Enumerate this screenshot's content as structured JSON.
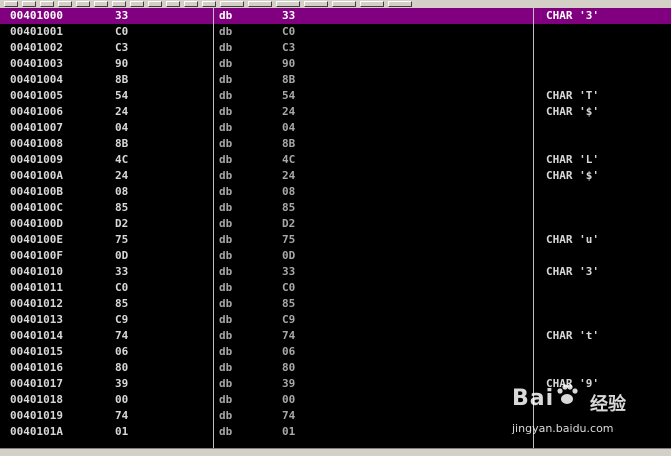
{
  "rows": [
    {
      "addr": "00401000",
      "hex": "33",
      "op": "db",
      "arg": "33",
      "comment": "CHAR '3'",
      "selected": true
    },
    {
      "addr": "00401001",
      "hex": "C0",
      "op": "db",
      "arg": "C0",
      "comment": ""
    },
    {
      "addr": "00401002",
      "hex": "C3",
      "op": "db",
      "arg": "C3",
      "comment": ""
    },
    {
      "addr": "00401003",
      "hex": "90",
      "op": "db",
      "arg": "90",
      "comment": ""
    },
    {
      "addr": "00401004",
      "hex": "8B",
      "op": "db",
      "arg": "8B",
      "comment": ""
    },
    {
      "addr": "00401005",
      "hex": "54",
      "op": "db",
      "arg": "54",
      "comment": "CHAR 'T'"
    },
    {
      "addr": "00401006",
      "hex": "24",
      "op": "db",
      "arg": "24",
      "comment": "CHAR '$'"
    },
    {
      "addr": "00401007",
      "hex": "04",
      "op": "db",
      "arg": "04",
      "comment": ""
    },
    {
      "addr": "00401008",
      "hex": "8B",
      "op": "db",
      "arg": "8B",
      "comment": ""
    },
    {
      "addr": "00401009",
      "hex": "4C",
      "op": "db",
      "arg": "4C",
      "comment": "CHAR 'L'"
    },
    {
      "addr": "0040100A",
      "hex": "24",
      "op": "db",
      "arg": "24",
      "comment": "CHAR '$'"
    },
    {
      "addr": "0040100B",
      "hex": "08",
      "op": "db",
      "arg": "08",
      "comment": ""
    },
    {
      "addr": "0040100C",
      "hex": "85",
      "op": "db",
      "arg": "85",
      "comment": ""
    },
    {
      "addr": "0040100D",
      "hex": "D2",
      "op": "db",
      "arg": "D2",
      "comment": ""
    },
    {
      "addr": "0040100E",
      "hex": "75",
      "op": "db",
      "arg": "75",
      "comment": "CHAR 'u'"
    },
    {
      "addr": "0040100F",
      "hex": "0D",
      "op": "db",
      "arg": "0D",
      "comment": ""
    },
    {
      "addr": "00401010",
      "hex": "33",
      "op": "db",
      "arg": "33",
      "comment": "CHAR '3'"
    },
    {
      "addr": "00401011",
      "hex": "C0",
      "op": "db",
      "arg": "C0",
      "comment": ""
    },
    {
      "addr": "00401012",
      "hex": "85",
      "op": "db",
      "arg": "85",
      "comment": ""
    },
    {
      "addr": "00401013",
      "hex": "C9",
      "op": "db",
      "arg": "C9",
      "comment": ""
    },
    {
      "addr": "00401014",
      "hex": "74",
      "op": "db",
      "arg": "74",
      "comment": "CHAR 't'"
    },
    {
      "addr": "00401015",
      "hex": "06",
      "op": "db",
      "arg": "06",
      "comment": ""
    },
    {
      "addr": "00401016",
      "hex": "80",
      "op": "db",
      "arg": "80",
      "comment": ""
    },
    {
      "addr": "00401017",
      "hex": "39",
      "op": "db",
      "arg": "39",
      "comment": "CHAR '9'"
    },
    {
      "addr": "00401018",
      "hex": "00",
      "op": "db",
      "arg": "00",
      "comment": ""
    },
    {
      "addr": "00401019",
      "hex": "74",
      "op": "db",
      "arg": "74",
      "comment": ""
    },
    {
      "addr": "0040101A",
      "hex": "01",
      "op": "db",
      "arg": "01",
      "comment": ""
    }
  ],
  "watermark": {
    "logo": "Bai",
    "cn": "经验",
    "url": "jingyan.baidu.com"
  },
  "colors": {
    "selection": "#800080",
    "background": "#000000",
    "text": "#d8d8d8"
  }
}
